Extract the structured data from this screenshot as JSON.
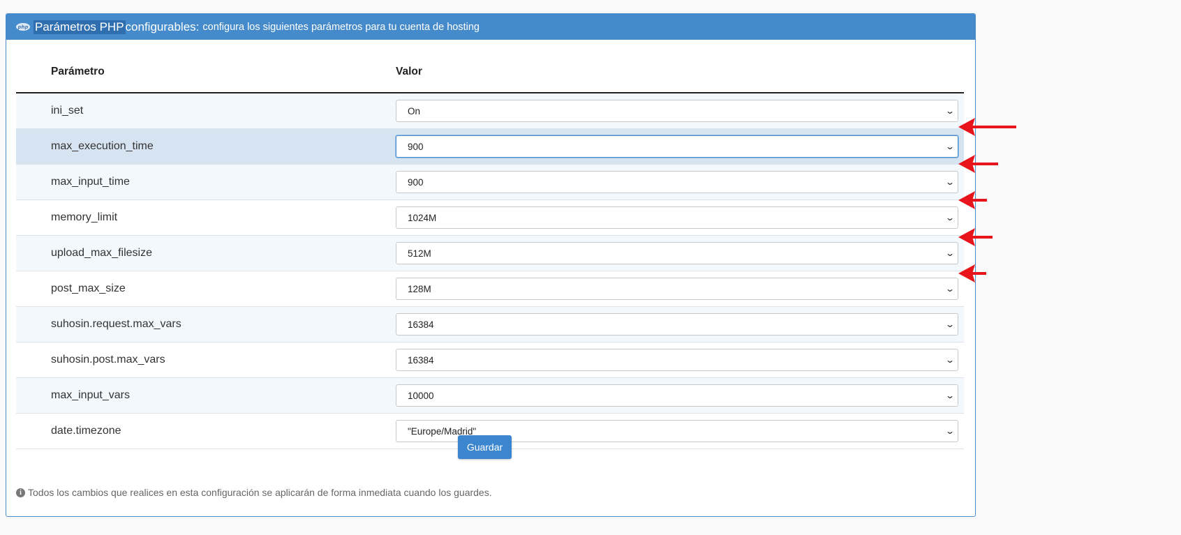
{
  "panel": {
    "icon": "php-icon",
    "title_highlight": "Parámetros PHP",
    "title_strong": "configurables:",
    "title_rest": "configura los siguientes parámetros para tu cuenta de hosting"
  },
  "table": {
    "headers": {
      "param": "Parámetro",
      "value": "Valor"
    },
    "rows": [
      {
        "param": "ini_set",
        "value": "On"
      },
      {
        "param": "max_execution_time",
        "value": "900"
      },
      {
        "param": "max_input_time",
        "value": "900"
      },
      {
        "param": "memory_limit",
        "value": "1024M"
      },
      {
        "param": "upload_max_filesize",
        "value": "512M"
      },
      {
        "param": "post_max_size",
        "value": "128M"
      },
      {
        "param": "suhosin.request.max_vars",
        "value": "16384"
      },
      {
        "param": "suhosin.post.max_vars",
        "value": "16384"
      },
      {
        "param": "max_input_vars",
        "value": "10000"
      },
      {
        "param": "date.timezone",
        "value": "\"Europe/Madrid\""
      }
    ]
  },
  "save_label": "Guardar",
  "footer_note": "Todos los cambios que realices en esta configuración se aplicarán de forma inmediata cuando los guardes.",
  "annotations": {
    "arrow_color": "#e8141b",
    "arrow_icon": "red-arrow-icon"
  }
}
